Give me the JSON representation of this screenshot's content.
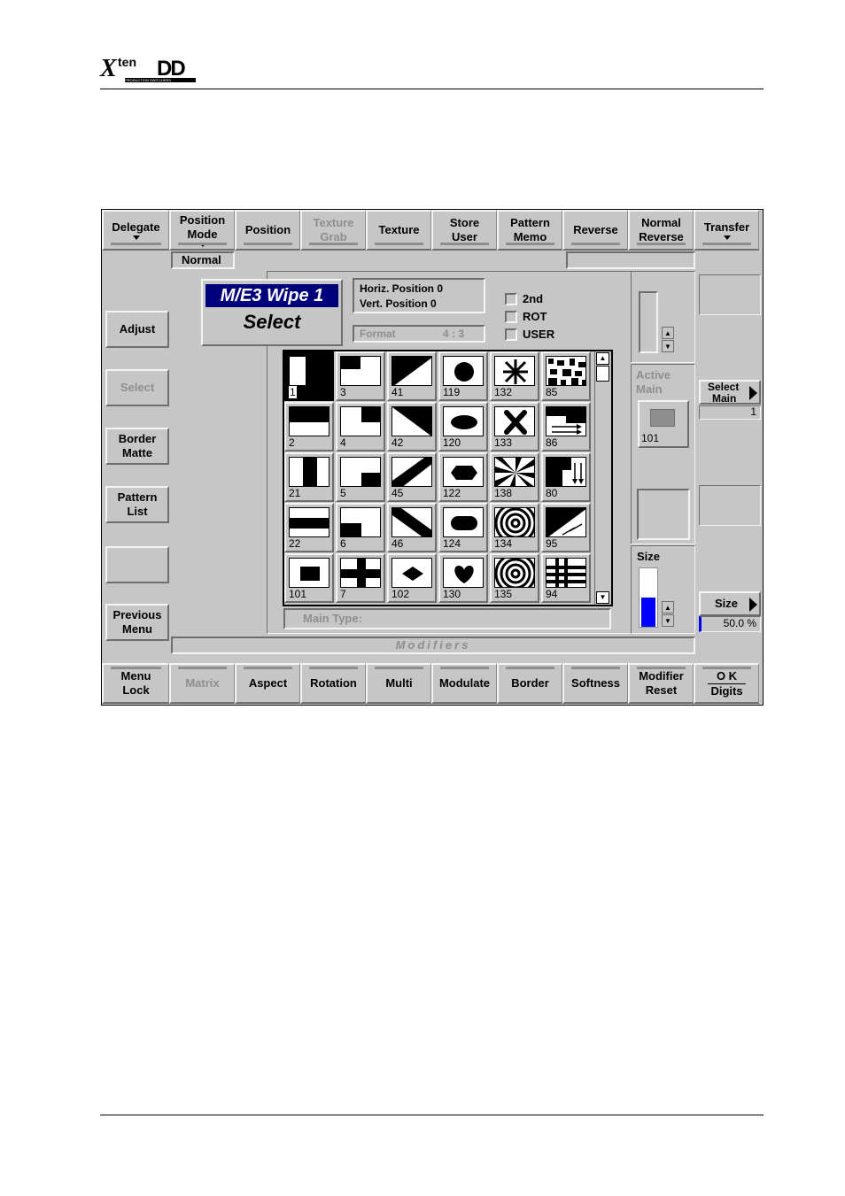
{
  "header": {
    "logo_x": "X",
    "logo_ten": "ten",
    "logo_dd": "DD",
    "logo_sub": "PRODUCTION SWITCHERS"
  },
  "top_menu": [
    {
      "label1": "Delegate",
      "label2": "",
      "dropdown": true,
      "dim": false
    },
    {
      "label1": "Position",
      "label2": "Mode",
      "dropdown": true,
      "dim": false
    },
    {
      "label1": "Position",
      "label2": "",
      "dropdown": false,
      "dim": false
    },
    {
      "label1": "Texture",
      "label2": "Grab",
      "dropdown": false,
      "dim": true
    },
    {
      "label1": "Texture",
      "label2": "",
      "dropdown": false,
      "dim": false
    },
    {
      "label1": "Store",
      "label2": "User",
      "dropdown": false,
      "dim": false
    },
    {
      "label1": "Pattern",
      "label2": "Memo",
      "dropdown": false,
      "dim": false
    },
    {
      "label1": "Reverse",
      "label2": "",
      "dropdown": false,
      "dim": false
    },
    {
      "label1": "Normal",
      "label2": "Reverse",
      "dropdown": false,
      "dim": false
    },
    {
      "label1": "Transfer",
      "label2": "",
      "dropdown": true,
      "dim": false
    }
  ],
  "mode_value": "Normal",
  "left_buttons": [
    {
      "label1": "Adjust",
      "label2": "",
      "dim": false
    },
    {
      "label1": "Select",
      "label2": "",
      "dim": true
    },
    {
      "label1": "Border",
      "label2": "Matte",
      "dim": false
    },
    {
      "label1": "Pattern",
      "label2": "List",
      "dim": false
    },
    {
      "label1": "",
      "label2": "",
      "dim": false
    },
    {
      "label1": "Previous",
      "label2": "Menu",
      "dim": false
    }
  ],
  "title_box": {
    "line1": "M/E3 Wipe 1",
    "line2": "Select"
  },
  "position_info": {
    "horiz": "Horiz. Position 0",
    "vert": "Vert.  Position 0"
  },
  "format": {
    "label": "Format",
    "value": "4 : 3"
  },
  "checkboxes": [
    "2nd",
    "ROT",
    "USER"
  ],
  "patterns": [
    [
      "1",
      "3",
      "41",
      "119",
      "132",
      "85"
    ],
    [
      "2",
      "4",
      "42",
      "120",
      "133",
      "86"
    ],
    [
      "21",
      "5",
      "45",
      "122",
      "138",
      "80"
    ],
    [
      "22",
      "6",
      "46",
      "124",
      "134",
      "95"
    ],
    [
      "101",
      "7",
      "102",
      "130",
      "135",
      "94"
    ]
  ],
  "main_type_label": "Main Type:",
  "modifiers_label": "Modifiers",
  "active_main": {
    "label1": "Active",
    "label2": "Main",
    "value": "101"
  },
  "size_panel": {
    "label": "Size",
    "fill_fraction": 0.5
  },
  "right_panel": {
    "select_main": {
      "label1": "Select",
      "label2": "Main",
      "value": "1"
    },
    "size": {
      "label": "Size",
      "value": "50.0 %"
    }
  },
  "bottom_menu": [
    {
      "label1": "Menu",
      "label2": "Lock",
      "dim": false
    },
    {
      "label1": "Matrix",
      "label2": "",
      "dim": true
    },
    {
      "label1": "Aspect",
      "label2": "",
      "dim": false
    },
    {
      "label1": "Rotation",
      "label2": "",
      "dim": false
    },
    {
      "label1": "Multi",
      "label2": "",
      "dim": false
    },
    {
      "label1": "Modulate",
      "label2": "",
      "dim": false
    },
    {
      "label1": "Border",
      "label2": "",
      "dim": false
    },
    {
      "label1": "Softness",
      "label2": "",
      "dim": false
    },
    {
      "label1": "Modifier",
      "label2": "Reset",
      "dim": false
    },
    {
      "label1": "O K",
      "label2": "Digits",
      "dim": false
    }
  ],
  "colors": {
    "panel": "#c6c6c6",
    "title_bg": "#00007b",
    "size_bar": "#0000ff"
  }
}
